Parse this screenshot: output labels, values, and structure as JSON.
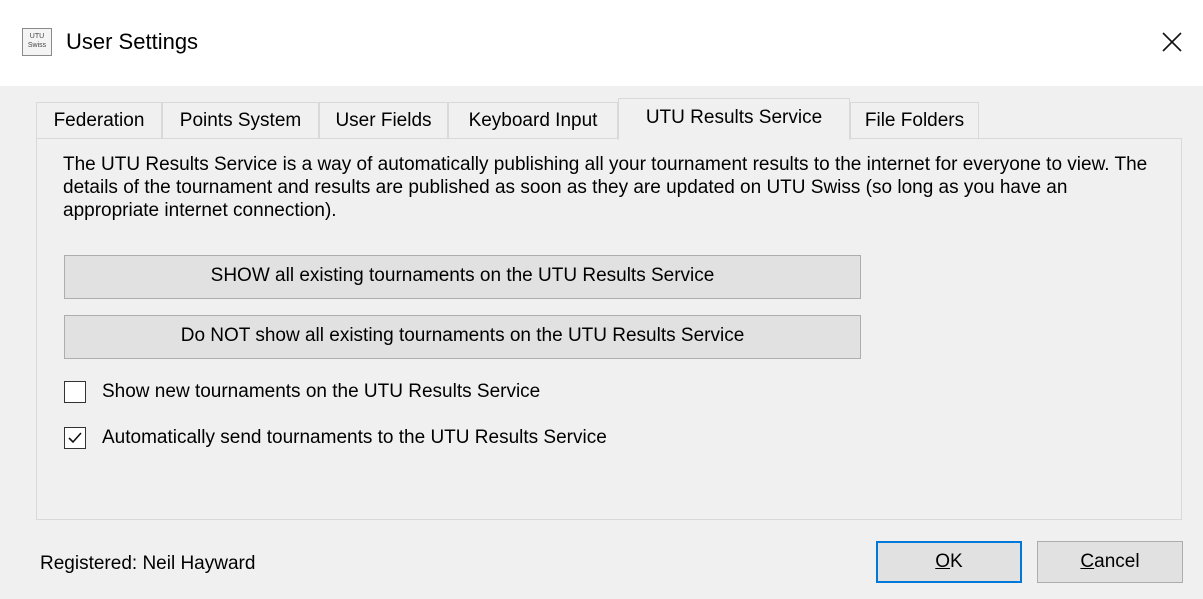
{
  "window": {
    "title": "User Settings",
    "icon_text_top": "UTU",
    "icon_text_bottom": "Swiss",
    "icon": "app-icon",
    "close_icon": "close-icon"
  },
  "tabs": [
    {
      "label": "Federation",
      "active": false
    },
    {
      "label": "Points System",
      "active": false
    },
    {
      "label": "User Fields",
      "active": false
    },
    {
      "label": "Keyboard Input",
      "active": false
    },
    {
      "label": "UTU Results Service",
      "active": true
    },
    {
      "label": "File Folders",
      "active": false
    }
  ],
  "panel": {
    "description": "The UTU Results Service is a way of automatically publishing all your tournament results to the internet for everyone to view.  The details of the tournament and results are published as soon as they are updated on UTU Swiss (so long as you have an appropriate internet connection).",
    "show_button": "SHOW all existing tournaments on the UTU Results Service",
    "hide_button": "Do NOT show all existing tournaments on the UTU Results Service",
    "checkboxes": [
      {
        "label": "Show new tournaments on the UTU Results Service",
        "checked": false
      },
      {
        "label": "Automatically send tournaments to the UTU Results Service",
        "checked": true
      }
    ]
  },
  "footer": {
    "registered": "Registered: Neil Hayward",
    "ok_mnemonic": "O",
    "ok_rest": "K",
    "cancel_mnemonic": "C",
    "cancel_rest": "ancel"
  },
  "colors": {
    "background": "#f0f0f0",
    "title_bar": "#ffffff",
    "button_face": "#e1e1e1",
    "default_button_border": "#0078d7"
  }
}
